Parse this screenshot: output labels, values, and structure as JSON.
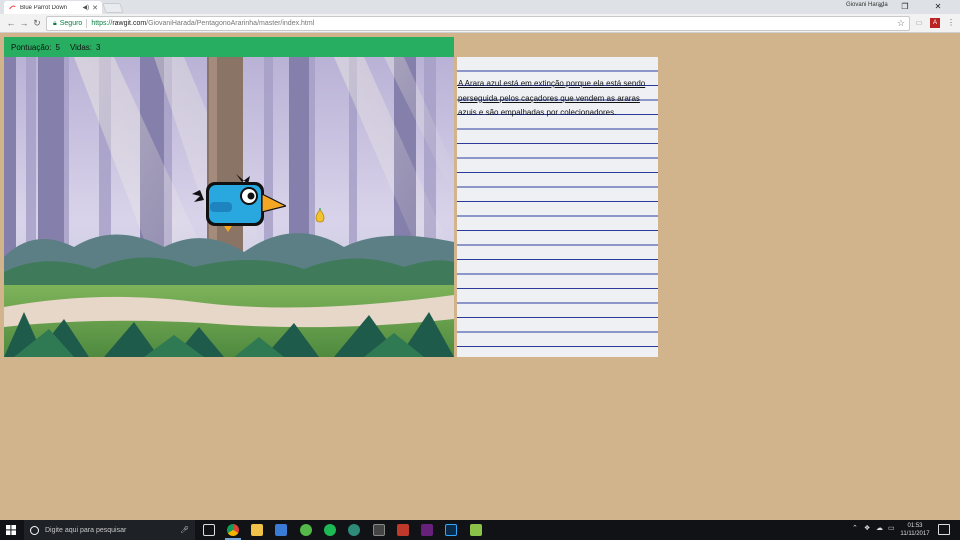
{
  "browser": {
    "tab_title": "Blue Parrot Down",
    "profile_name": "Giovani Harada",
    "security_label": "Seguro",
    "url_scheme": "https://",
    "url_host": "rawgit.com",
    "url_path": "/GiovaniHarada/PentagonoArarinha/master/index.html"
  },
  "game": {
    "score_label": "Pontuação:",
    "score_value": "5",
    "lives_label": "Vidas:",
    "lives_value": "3"
  },
  "notebook": {
    "text_underlined": "A Arara azul está em extinção porque ela está sendo perseguida pelos caçadores que vendem as araras",
    "text_plain": " azuis e são empalhadas por colecionadores."
  },
  "taskbar": {
    "search_placeholder": "Digite aqui para pesquisar",
    "time": "01:53",
    "date": "11/11/2017"
  },
  "colors": {
    "page_background": "#d2b48c",
    "score_bar": "#27ae60",
    "notebook_lines": "#2a3b9c",
    "parrot": "#29a8e0"
  }
}
